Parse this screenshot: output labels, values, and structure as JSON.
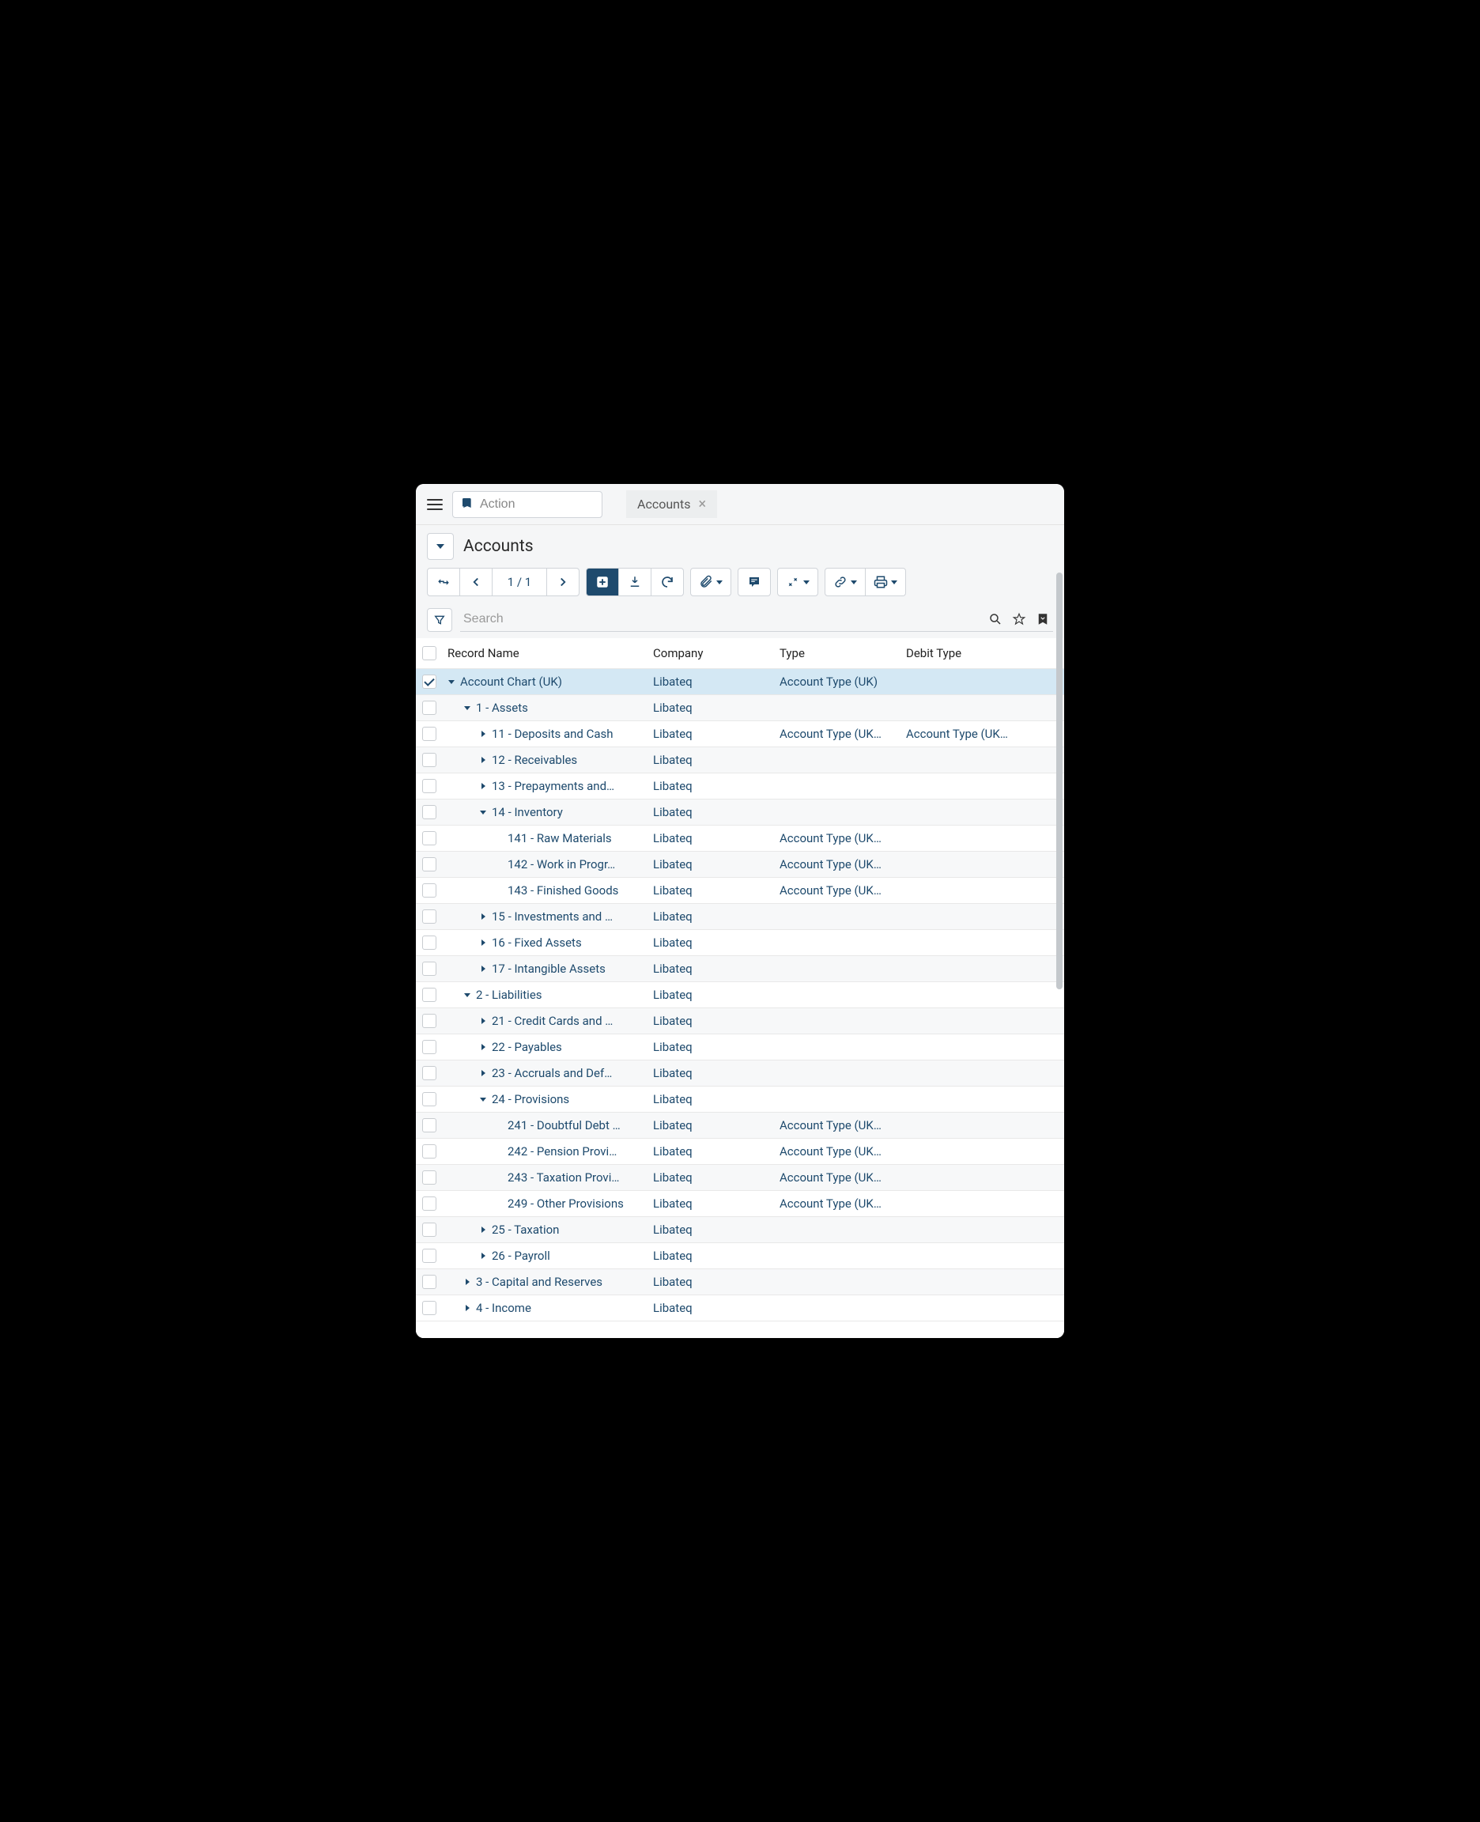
{
  "top": {
    "action_placeholder": "Action",
    "tab_label": "Accounts"
  },
  "header": {
    "title": "Accounts"
  },
  "toolbar": {
    "page_indicator": "1 / 1"
  },
  "search": {
    "placeholder": "Search"
  },
  "columns": {
    "record": "Record Name",
    "company": "Company",
    "type": "Type",
    "debit": "Debit Type"
  },
  "rows": [
    {
      "indent": 0,
      "toggle": "open",
      "checked": true,
      "selected": true,
      "name": "Account Chart (UK)",
      "company": "Libateq",
      "type": "Account Type (UK)",
      "debit": ""
    },
    {
      "indent": 1,
      "toggle": "open",
      "name": "1 - Assets",
      "company": "Libateq",
      "type": "",
      "debit": ""
    },
    {
      "indent": 2,
      "toggle": "closed",
      "name": "11 - Deposits and Cash",
      "company": "Libateq",
      "type": "Account Type (UK…",
      "debit": "Account Type (UK…"
    },
    {
      "indent": 2,
      "toggle": "closed",
      "name": "12 - Receivables",
      "company": "Libateq",
      "type": "",
      "debit": ""
    },
    {
      "indent": 2,
      "toggle": "closed",
      "name": "13 - Prepayments and…",
      "company": "Libateq",
      "type": "",
      "debit": ""
    },
    {
      "indent": 2,
      "toggle": "open",
      "name": "14 - Inventory",
      "company": "Libateq",
      "type": "",
      "debit": ""
    },
    {
      "indent": 3,
      "toggle": "none",
      "name": "141 - Raw Materials",
      "company": "Libateq",
      "type": "Account Type (UK…",
      "debit": ""
    },
    {
      "indent": 3,
      "toggle": "none",
      "name": "142 - Work in Progr…",
      "company": "Libateq",
      "type": "Account Type (UK…",
      "debit": ""
    },
    {
      "indent": 3,
      "toggle": "none",
      "name": "143 - Finished Goods",
      "company": "Libateq",
      "type": "Account Type (UK…",
      "debit": ""
    },
    {
      "indent": 2,
      "toggle": "closed",
      "name": "15 - Investments and …",
      "company": "Libateq",
      "type": "",
      "debit": ""
    },
    {
      "indent": 2,
      "toggle": "closed",
      "name": "16 - Fixed Assets",
      "company": "Libateq",
      "type": "",
      "debit": ""
    },
    {
      "indent": 2,
      "toggle": "closed",
      "name": "17 - Intangible Assets",
      "company": "Libateq",
      "type": "",
      "debit": ""
    },
    {
      "indent": 1,
      "toggle": "open",
      "name": "2 - Liabilities",
      "company": "Libateq",
      "type": "",
      "debit": ""
    },
    {
      "indent": 2,
      "toggle": "closed",
      "name": "21 - Credit Cards and …",
      "company": "Libateq",
      "type": "",
      "debit": ""
    },
    {
      "indent": 2,
      "toggle": "closed",
      "name": "22 - Payables",
      "company": "Libateq",
      "type": "",
      "debit": ""
    },
    {
      "indent": 2,
      "toggle": "closed",
      "name": "23 - Accruals and Def…",
      "company": "Libateq",
      "type": "",
      "debit": ""
    },
    {
      "indent": 2,
      "toggle": "open",
      "name": "24 - Provisions",
      "company": "Libateq",
      "type": "",
      "debit": ""
    },
    {
      "indent": 3,
      "toggle": "none",
      "name": "241 - Doubtful Debt …",
      "company": "Libateq",
      "type": "Account Type (UK…",
      "debit": ""
    },
    {
      "indent": 3,
      "toggle": "none",
      "name": "242 - Pension Provi…",
      "company": "Libateq",
      "type": "Account Type (UK…",
      "debit": ""
    },
    {
      "indent": 3,
      "toggle": "none",
      "name": "243 - Taxation Provi…",
      "company": "Libateq",
      "type": "Account Type (UK…",
      "debit": ""
    },
    {
      "indent": 3,
      "toggle": "none",
      "name": "249 - Other Provisions",
      "company": "Libateq",
      "type": "Account Type (UK…",
      "debit": ""
    },
    {
      "indent": 2,
      "toggle": "closed",
      "name": "25 - Taxation",
      "company": "Libateq",
      "type": "",
      "debit": ""
    },
    {
      "indent": 2,
      "toggle": "closed",
      "name": "26 - Payroll",
      "company": "Libateq",
      "type": "",
      "debit": ""
    },
    {
      "indent": 1,
      "toggle": "closed",
      "name": "3 - Capital and Reserves",
      "company": "Libateq",
      "type": "",
      "debit": ""
    },
    {
      "indent": 1,
      "toggle": "closed",
      "name": "4 - Income",
      "company": "Libateq",
      "type": "",
      "debit": ""
    }
  ]
}
